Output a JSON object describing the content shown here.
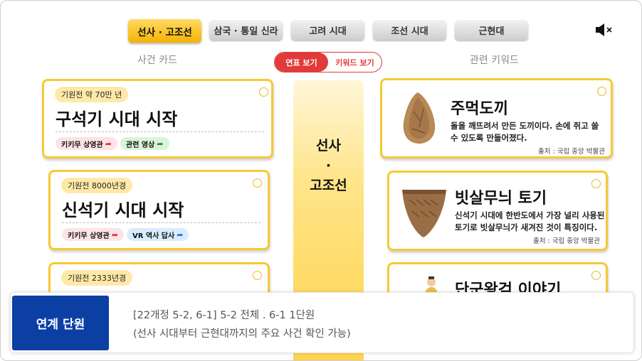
{
  "tabs": [
    {
      "label": "선사 · 고조선",
      "active": true
    },
    {
      "label": "삼국 · 통일 신라",
      "active": false
    },
    {
      "label": "고려 시대",
      "active": false
    },
    {
      "label": "조선 시대",
      "active": false
    },
    {
      "label": "근현대",
      "active": false
    }
  ],
  "columns": {
    "left": "사건 카드",
    "right": "관련 키워드"
  },
  "view_toggle": {
    "timeline": "연표 보기",
    "keyword": "키워드 보기",
    "selected": "연표 보기"
  },
  "pillar": {
    "line1": "선사",
    "line2": "·",
    "line3": "고조선"
  },
  "event_cards": [
    {
      "date": "기원전 약 70만 년",
      "title": "구석기 시대 시작",
      "tags": [
        {
          "text": "키키무 상영관",
          "color": "pink"
        },
        {
          "text": "관련 영상",
          "color": "green"
        }
      ]
    },
    {
      "date": "기원전 8000년경",
      "title": "신석기 시대 시작",
      "tags": [
        {
          "text": "키키무 상영관",
          "color": "pink"
        },
        {
          "text": "VR 역사 답사",
          "color": "blue"
        }
      ]
    },
    {
      "date": "기원전 2333년경",
      "title": "",
      "tags": []
    }
  ],
  "keyword_cards": [
    {
      "title": "주먹도끼",
      "desc1": "돌을 깨뜨려서 만든 도끼이다. 손에 쥐고 쓸",
      "desc2": "수 있도록 만들어졌다.",
      "source": "출처 : 국립 중앙 박물관",
      "icon": "hand-axe-icon"
    },
    {
      "title": "빗살무늬 토기",
      "desc1": "신석기 시대에 한반도에서 가장 널리 사용된",
      "desc2": "토기로 빗살무늬가 새겨진 것이 특징이다.",
      "source": "출처 : 국립 중앙 박물관",
      "icon": "pottery-icon"
    },
    {
      "title": "단군왕검 이야기",
      "icon": "dangun-figure-icon"
    }
  ],
  "info": {
    "label": "연계 단원",
    "line1": "[22개정 5-2, 6-1] 5-2 전체 . 6-1 1단원",
    "line2": "(선사 시대부터 근현대까지의 주요 사건 확인 가능)"
  },
  "colors": {
    "accent": "#f4b400",
    "card_border": "#f7c933",
    "toggle_red": "#e23a3a",
    "info_blue": "#0b3fa3"
  },
  "icons": {
    "mute": "speaker-mute-icon"
  }
}
